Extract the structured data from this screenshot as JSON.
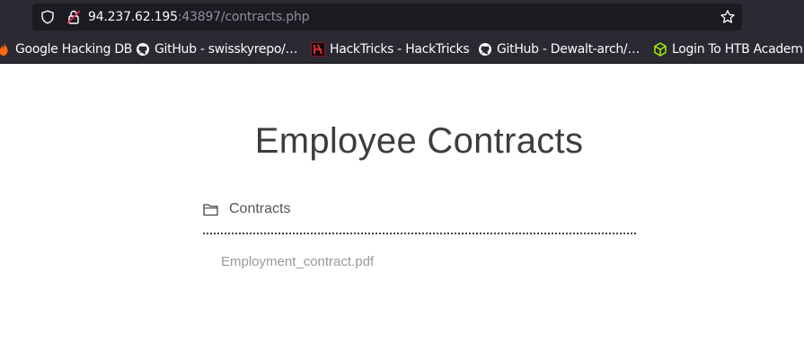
{
  "browser": {
    "url_host": "94.237.62.195",
    "url_rest": ":43897/contracts.php",
    "bookmarks": [
      {
        "label": "Google Hacking DB",
        "icon": "flame-icon"
      },
      {
        "label": "GitHub - swisskyrepo/…",
        "icon": "github-icon"
      },
      {
        "label": "HackTricks - HackTricks",
        "icon": "hacktricks-icon"
      },
      {
        "label": "GitHub - Dewalt-arch/…",
        "icon": "github-icon"
      },
      {
        "label": "Login To HTB Academ…",
        "icon": "htb-cube-icon"
      }
    ]
  },
  "page": {
    "title": "Employee Contracts",
    "folder": {
      "label": "Contracts",
      "icon": "folder-icon"
    },
    "files": [
      "Employment_contract.pdf"
    ]
  },
  "colors": {
    "chrome_bg": "#2b2a33",
    "urlbar_bg": "#1c1b22",
    "title_text": "#3d3d3d",
    "file_link": "#999999",
    "htb_green": "#9fef00"
  }
}
